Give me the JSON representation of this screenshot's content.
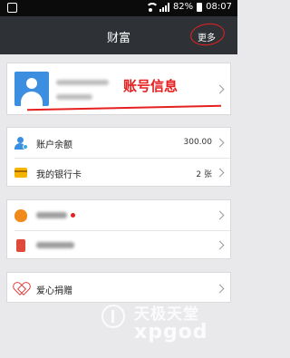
{
  "status_bar": {
    "battery_text": "82%",
    "time": "08:07"
  },
  "header": {
    "title": "财富",
    "more_label": "更多"
  },
  "account": {
    "annotation": "账号信息"
  },
  "balance": {
    "label": "账户余额",
    "value": "300.00"
  },
  "bank_card": {
    "label": "我的银行卡",
    "value": "2 张"
  },
  "donation": {
    "label": "爱心捐赠"
  },
  "watermark": {
    "cn": "天极天堂",
    "en": "xpgod"
  },
  "colors": {
    "header_bg": "#2e3236",
    "accent_red": "#e62020",
    "avatar_blue": "#3c8ee0",
    "page_bg": "#e9e9ec"
  }
}
